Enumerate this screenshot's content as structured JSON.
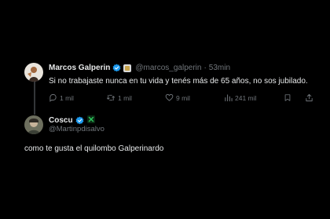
{
  "parent_tweet": {
    "author_name": "Marcos Galperin",
    "handle": "@marcos_galperin",
    "separator": "·",
    "time": "53min",
    "text": "Si no trabajaste nunca en tu vida y tenés más de 65 años, no sos jubilado.",
    "stats": {
      "replies": "1 mil",
      "retweets": "1 mil",
      "likes": "9 mil",
      "views": "241 mil"
    }
  },
  "reply_tweet": {
    "author_name": "Coscu",
    "badge": "x-icon",
    "handle": "@Martinpdisalvo",
    "text": "como te gusta el quilombo Galperinardo"
  },
  "colors": {
    "background": "#000000",
    "text_primary": "#e7e9ea",
    "text_secondary": "#71767b",
    "verified": "#1d9bf0",
    "coscu_badge": "#2bc45a"
  }
}
